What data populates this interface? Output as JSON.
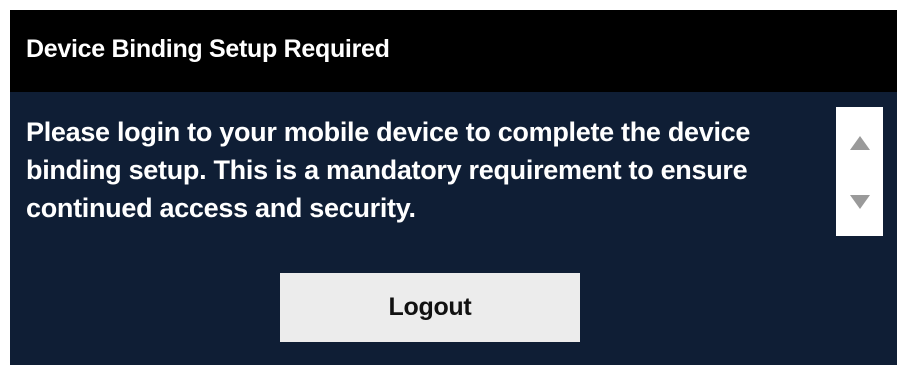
{
  "dialog": {
    "title": "Device Binding Setup Required",
    "message": "Please login to your mobile device to complete the device binding setup. This is a mandatory requirement to ensure continued access and security.",
    "logout_label": "Logout"
  },
  "scrollbar": {
    "up_icon": "triangle-up-icon",
    "down_icon": "triangle-down-icon"
  },
  "colors": {
    "titlebar_bg": "#000000",
    "dialog_bg": "#0f1e35",
    "text": "#ffffff",
    "button_bg": "#ececec",
    "arrow": "#9a9a9a"
  }
}
